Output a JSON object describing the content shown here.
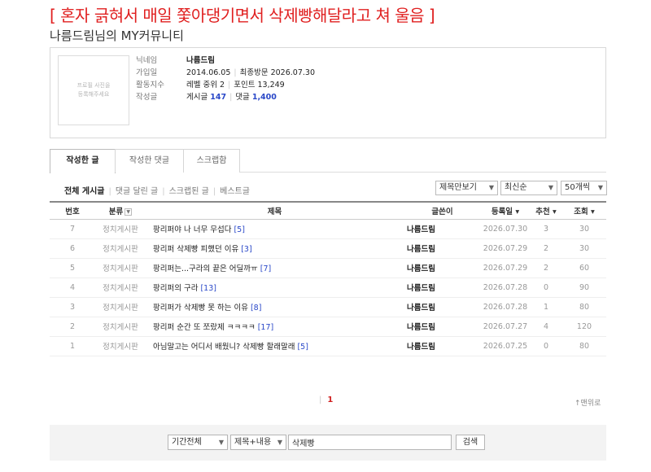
{
  "headline": "[ 혼자 긁혀서 매일 쫓아댕기면서 삭제빵해달라고 쳐 울음 ]",
  "page_title": "나름드림님의 MY커뮤니티",
  "profile": {
    "photo_text_1": "프로필 사진을",
    "photo_text_2": "등록해주세요",
    "nick_label": "닉네임",
    "nick": "나름드림",
    "join_label": "가입일",
    "join_date": "2014.06.05",
    "last_visit": "최종방문 2026.07.30",
    "activity_label": "활동지수",
    "level": "레벨 중위 2",
    "points": "포인트 13,249",
    "posts_label": "작성글",
    "posts_prefix": "게시글",
    "posts_count": "147",
    "comments_prefix": "댓글",
    "comments_count": "1,400"
  },
  "tabs": [
    "작성한 글",
    "작성한 댓글",
    "스크랩함"
  ],
  "subtabs": [
    "전체 게시글",
    "댓글 달린 글",
    "스크랩된 글",
    "베스트글"
  ],
  "selects": {
    "view_mode": "제목만보기",
    "sort": "최신순",
    "per_page": "50개씩"
  },
  "table": {
    "headers": {
      "num": "번호",
      "category": "분류",
      "title": "제목",
      "author": "글쓴이",
      "date": "등록일",
      "recommend": "추천",
      "views": "조회"
    },
    "rows": [
      {
        "num": "7",
        "category": "정치게시판",
        "title": "팡리퍼야 나 너무 무섭다",
        "comments": "[5]",
        "author": "나름드림",
        "date": "2026.07.30",
        "recommend": "3",
        "views": "30"
      },
      {
        "num": "6",
        "category": "정치게시판",
        "title": "팡리퍼 삭제빵 피했던 이유",
        "comments": "[3]",
        "author": "나름드림",
        "date": "2026.07.29",
        "recommend": "2",
        "views": "30"
      },
      {
        "num": "5",
        "category": "정치게시판",
        "title": "팡리퍼는...구라의 끝은 어딜까ㅠ",
        "comments": "[7]",
        "author": "나름드림",
        "date": "2026.07.29",
        "recommend": "2",
        "views": "60"
      },
      {
        "num": "4",
        "category": "정치게시판",
        "title": "팡리퍼의 구라",
        "comments": "[13]",
        "author": "나름드림",
        "date": "2026.07.28",
        "recommend": "0",
        "views": "90"
      },
      {
        "num": "3",
        "category": "정치게시판",
        "title": "팡리퍼가 삭제빵 못 하는 이유",
        "comments": "[8]",
        "author": "나름드림",
        "date": "2026.07.28",
        "recommend": "1",
        "views": "80"
      },
      {
        "num": "2",
        "category": "정치게시판",
        "title": "팡리퍼 순간 또 쪼랐제 ㅋㅋㅋㅋ",
        "comments": "[17]",
        "author": "나름드림",
        "date": "2026.07.27",
        "recommend": "4",
        "views": "120"
      },
      {
        "num": "1",
        "category": "정치게시판",
        "title": "아님말고는 어디서 배웠니? 삭제빵 할래말래",
        "comments": "[5]",
        "author": "나름드림",
        "date": "2026.07.25",
        "recommend": "0",
        "views": "80"
      }
    ]
  },
  "pager": {
    "current": "1"
  },
  "totop": "↑맨위로",
  "search": {
    "period": "기간전체",
    "field": "제목+내용",
    "query": "삭제빵",
    "button": "검색"
  },
  "colors": {
    "headline": "#e02020",
    "accent_blue": "#2a48c8",
    "recommend_orange": "#e8862a",
    "current_page": "#d02020"
  }
}
